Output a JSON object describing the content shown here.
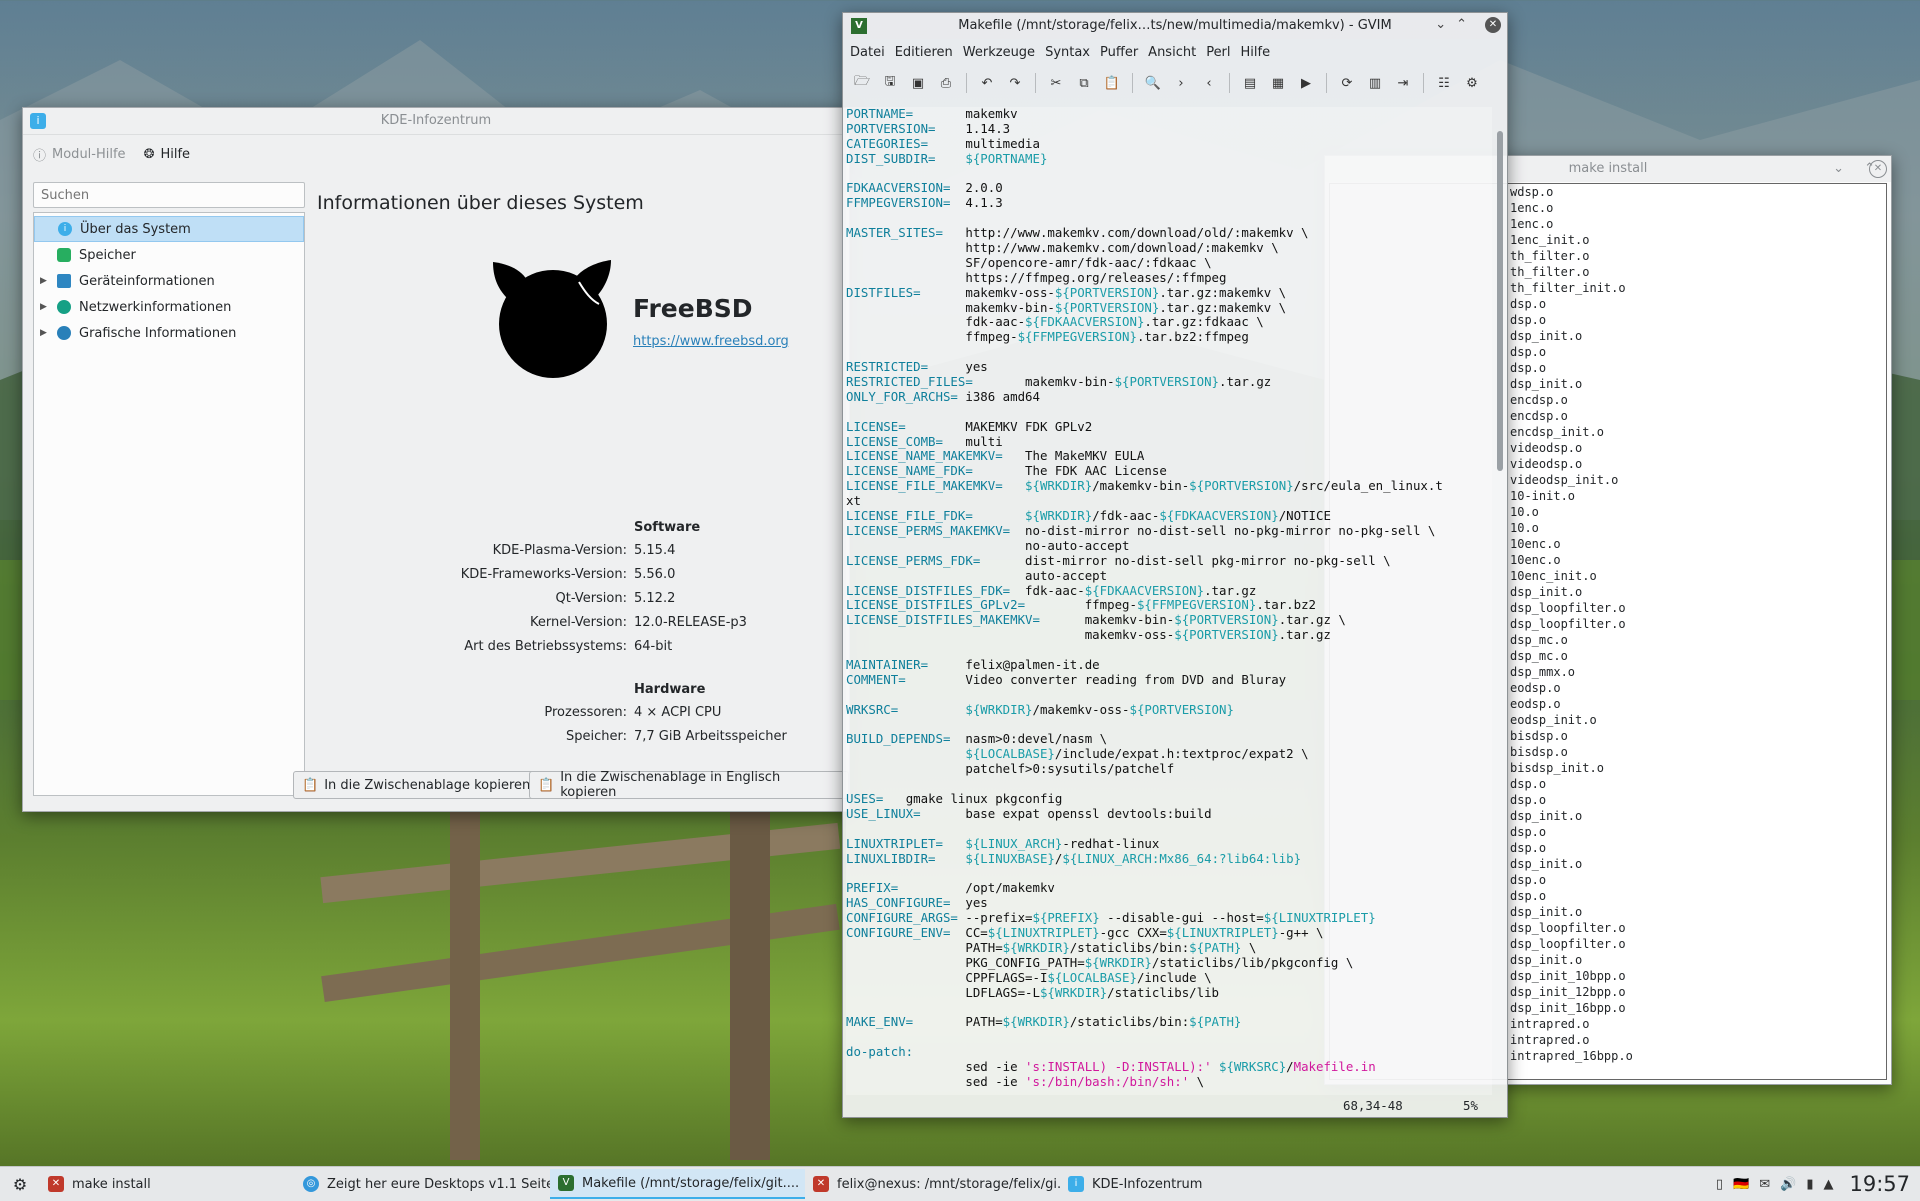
{
  "kde": {
    "title": "KDE-Infozentrum",
    "toolbar": {
      "help_module": "Modul-Hilfe",
      "help": "Hilfe"
    },
    "search_placeholder": "Suchen",
    "tree": [
      {
        "label": "Über das System",
        "icon": "info-icon",
        "selected": true,
        "expandable": false
      },
      {
        "label": "Speicher",
        "icon": "memory-icon",
        "selected": false,
        "expandable": false
      },
      {
        "label": "Geräteinformationen",
        "icon": "device-icon",
        "selected": false,
        "expandable": true
      },
      {
        "label": "Netzwerkinformationen",
        "icon": "network-icon",
        "selected": false,
        "expandable": true
      },
      {
        "label": "Grafische Informationen",
        "icon": "graphics-icon",
        "selected": false,
        "expandable": true
      }
    ],
    "heading": "Informationen über dieses System",
    "os_name": "FreeBSD",
    "os_url": "https://www.freebsd.org",
    "software_heading": "Software",
    "software": [
      {
        "k": "KDE-Plasma-Version:",
        "v": "5.15.4"
      },
      {
        "k": "KDE-Frameworks-Version:",
        "v": "5.56.0"
      },
      {
        "k": "Qt-Version:",
        "v": "5.12.2"
      },
      {
        "k": "Kernel-Version:",
        "v": "12.0-RELEASE-p3"
      },
      {
        "k": "Art des Betriebssystems:",
        "v": "64-bit"
      }
    ],
    "hardware_heading": "Hardware",
    "hardware": [
      {
        "k": "Prozessoren:",
        "v": "4 × ACPI CPU"
      },
      {
        "k": "Speicher:",
        "v": "7,7 GiB Arbeitsspeicher"
      }
    ],
    "copy_btn": "In die Zwischenablage kopieren",
    "copy_en_btn": "In die Zwischenablage in Englisch kopieren"
  },
  "gvim": {
    "title": "Makefile (/mnt/storage/felix…ts/new/multimedia/makemkv) - GVIM",
    "menu": [
      "Datei",
      "Editieren",
      "Werkzeuge",
      "Syntax",
      "Puffer",
      "Ansicht",
      "Perl",
      "Hilfe"
    ],
    "status_pos": "68,34-48",
    "status_pct": "5%",
    "lines": [
      "PORTNAME=       makemkv",
      "PORTVERSION=    1.14.3",
      "CATEGORIES=     multimedia",
      "DIST_SUBDIR=    ${PORTNAME}",
      "",
      "FDKAACVERSION=  2.0.0",
      "FFMPEGVERSION=  4.1.3",
      "",
      "MASTER_SITES=   http://www.makemkv.com/download/old/:makemkv \\",
      "                http://www.makemkv.com/download/:makemkv \\",
      "                SF/opencore-amr/fdk-aac/:fdkaac \\",
      "                https://ffmpeg.org/releases/:ffmpeg",
      "DISTFILES=      makemkv-oss-${PORTVERSION}.tar.gz:makemkv \\",
      "                makemkv-bin-${PORTVERSION}.tar.gz:makemkv \\",
      "                fdk-aac-${FDKAACVERSION}.tar.gz:fdkaac \\",
      "                ffmpeg-${FFMPEGVERSION}.tar.bz2:ffmpeg",
      "",
      "RESTRICTED=     yes",
      "RESTRICTED_FILES=       makemkv-bin-${PORTVERSION}.tar.gz",
      "ONLY_FOR_ARCHS= i386 amd64",
      "",
      "LICENSE=        MAKEMKV FDK GPLv2",
      "LICENSE_COMB=   multi",
      "LICENSE_NAME_MAKEMKV=   The MakeMKV EULA",
      "LICENSE_NAME_FDK=       The FDK AAC License",
      "LICENSE_FILE_MAKEMKV=   ${WRKDIR}/makemkv-bin-${PORTVERSION}/src/eula_en_linux.t",
      "xt",
      "LICENSE_FILE_FDK=       ${WRKDIR}/fdk-aac-${FDKAACVERSION}/NOTICE",
      "LICENSE_PERMS_MAKEMKV=  no-dist-mirror no-dist-sell no-pkg-mirror no-pkg-sell \\",
      "                        no-auto-accept",
      "LICENSE_PERMS_FDK=      dist-mirror no-dist-sell pkg-mirror no-pkg-sell \\",
      "                        auto-accept",
      "LICENSE_DISTFILES_FDK=  fdk-aac-${FDKAACVERSION}.tar.gz",
      "LICENSE_DISTFILES_GPLv2=        ffmpeg-${FFMPEGVERSION}.tar.bz2",
      "LICENSE_DISTFILES_MAKEMKV=      makemkv-bin-${PORTVERSION}.tar.gz \\",
      "                                makemkv-oss-${PORTVERSION}.tar.gz",
      "",
      "MAINTAINER=     felix@palmen-it.de",
      "COMMENT=        Video converter reading from DVD and Bluray",
      "",
      "WRKSRC=         ${WRKDIR}/makemkv-oss-${PORTVERSION}",
      "",
      "BUILD_DEPENDS=  nasm>0:devel/nasm \\",
      "                ${LOCALBASE}/include/expat.h:textproc/expat2 \\",
      "                patchelf>0:sysutils/patchelf",
      "",
      "USES=   gmake linux pkgconfig",
      "USE_LINUX=      base expat openssl devtools:build",
      "",
      "LINUXTRIPLET=   ${LINUX_ARCH}-redhat-linux",
      "LINUXLIBDIR=    ${LINUXBASE}/${LINUX_ARCH:Mx86_64:?lib64:lib}",
      "",
      "PREFIX=         /opt/makemkv",
      "HAS_CONFIGURE=  yes",
      "CONFIGURE_ARGS= --prefix=${PREFIX} --disable-gui --host=${LINUXTRIPLET}",
      "CONFIGURE_ENV=  CC=${LINUXTRIPLET}-gcc CXX=${LINUXTRIPLET}-g++ \\",
      "                PATH=${WRKDIR}/staticlibs/bin:${PATH} \\",
      "                PKG_CONFIG_PATH=${WRKDIR}/staticlibs/lib/pkgconfig \\",
      "                CPPFLAGS=-I${LOCALBASE}/include \\",
      "                LDFLAGS=-L${WRKDIR}/staticlibs/lib",
      "",
      "MAKE_ENV=       PATH=${WRKDIR}/staticlibs/bin:${PATH}",
      "",
      "do-patch:",
      "                sed -ie 's:INSTALL) -D:INSTALL):' ${WRKSRC}/Makefile.in",
      "                sed -ie 's:/bin/bash:/bin/sh:' \\"
    ]
  },
  "term": {
    "title": "make install",
    "lines": [
      "wdsp.o",
      "1enc.o",
      "1enc.o",
      "1enc_init.o",
      "th_filter.o",
      "th_filter.o",
      "th_filter_init.o",
      "dsp.o",
      "dsp.o",
      "dsp_init.o",
      "dsp.o",
      "dsp.o",
      "dsp_init.o",
      "encdsp.o",
      "encdsp.o",
      "encdsp_init.o",
      "videodsp.o",
      "videodsp.o",
      "videodsp_init.o",
      "10-init.o",
      "10.o",
      "10.o",
      "10enc.o",
      "10enc.o",
      "10enc_init.o",
      "dsp_init.o",
      "dsp_loopfilter.o",
      "dsp_loopfilter.o",
      "dsp_mc.o",
      "dsp_mc.o",
      "dsp_mmx.o",
      "eodsp.o",
      "eodsp.o",
      "eodsp_init.o",
      "bisdsp.o",
      "bisdsp.o",
      "bisdsp_init.o",
      "dsp.o",
      "dsp.o",
      "dsp_init.o",
      "dsp.o",
      "dsp.o",
      "dsp_init.o",
      "dsp.o",
      "dsp.o",
      "dsp_init.o",
      "dsp_loopfilter.o",
      "dsp_loopfilter.o",
      "dsp_init.o",
      "dsp_init_10bpp.o",
      "dsp_init_12bpp.o",
      "dsp_init_16bpp.o",
      "intrapred.o",
      "intrapred.o",
      "intrapred_16bpp.o"
    ]
  },
  "taskbar": {
    "tasks": [
      {
        "label": "make install",
        "icon": "terminal-icon",
        "active": false
      },
      {
        "label": "Zeigt her eure Desktops v1.1 Seite...",
        "icon": "browser-icon",
        "active": false
      },
      {
        "label": "Makefile (/mnt/storage/felix/git....",
        "icon": "gvim-icon",
        "active": true
      },
      {
        "label": "felix@nexus: /mnt/storage/felix/gi...",
        "icon": "terminal-icon",
        "active": false
      },
      {
        "label": "KDE-Infozentrum",
        "icon": "info-icon",
        "active": false
      }
    ],
    "clock": "19:57"
  },
  "colors": {
    "accent": "#3daee9",
    "vim_var": "#0e7f9b",
    "vim_string": "#d1189c"
  }
}
